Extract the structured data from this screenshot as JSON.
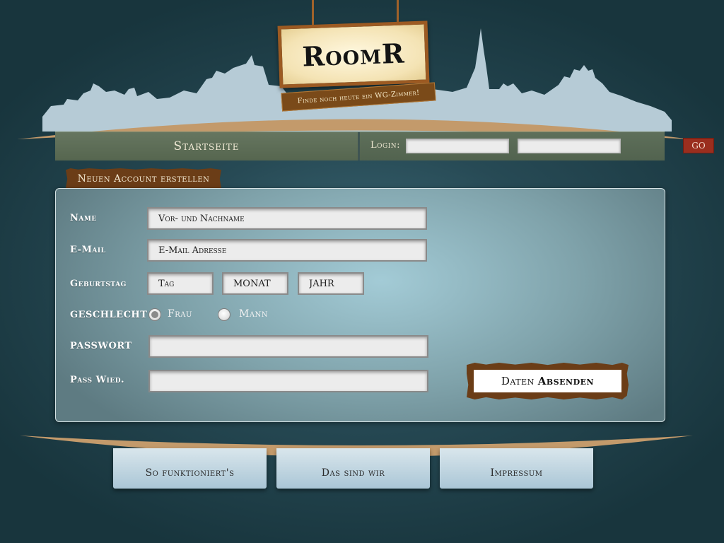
{
  "brand": {
    "logo": "RoomR",
    "slogan": "Finde noch heute ein WG-Zimmer!"
  },
  "nav": {
    "home": "Startseite",
    "login_label": "Login:",
    "login_user_value": "",
    "login_pass_value": "",
    "go_label": "GO"
  },
  "form": {
    "title": "Neuen Account erstellen",
    "name_label": "Name",
    "name_placeholder": "Vor- und Nachname",
    "email_label": "E-Mail",
    "email_placeholder": "E-Mail Adresse",
    "birthday_label": "Geburtstag",
    "day_placeholder": "Tag",
    "month_placeholder": "MONAT",
    "year_placeholder": "JAHR",
    "gender_label": "GESCHLECHT",
    "gender_options": [
      "Frau",
      "Mann"
    ],
    "gender_selected": "Frau",
    "password_label": "PASSWORT",
    "password_repeat_label": "Pass Wied.",
    "submit_label_1": "Daten",
    "submit_label_2": "Absenden"
  },
  "footer": {
    "links": [
      "So funktioniert's",
      "Das sind wir",
      "Impressum"
    ]
  },
  "colors": {
    "wood": "#6b3d17",
    "go_button": "#9a2e1e",
    "skyline": "#b6cbd6",
    "curve": "#c39a6b"
  }
}
